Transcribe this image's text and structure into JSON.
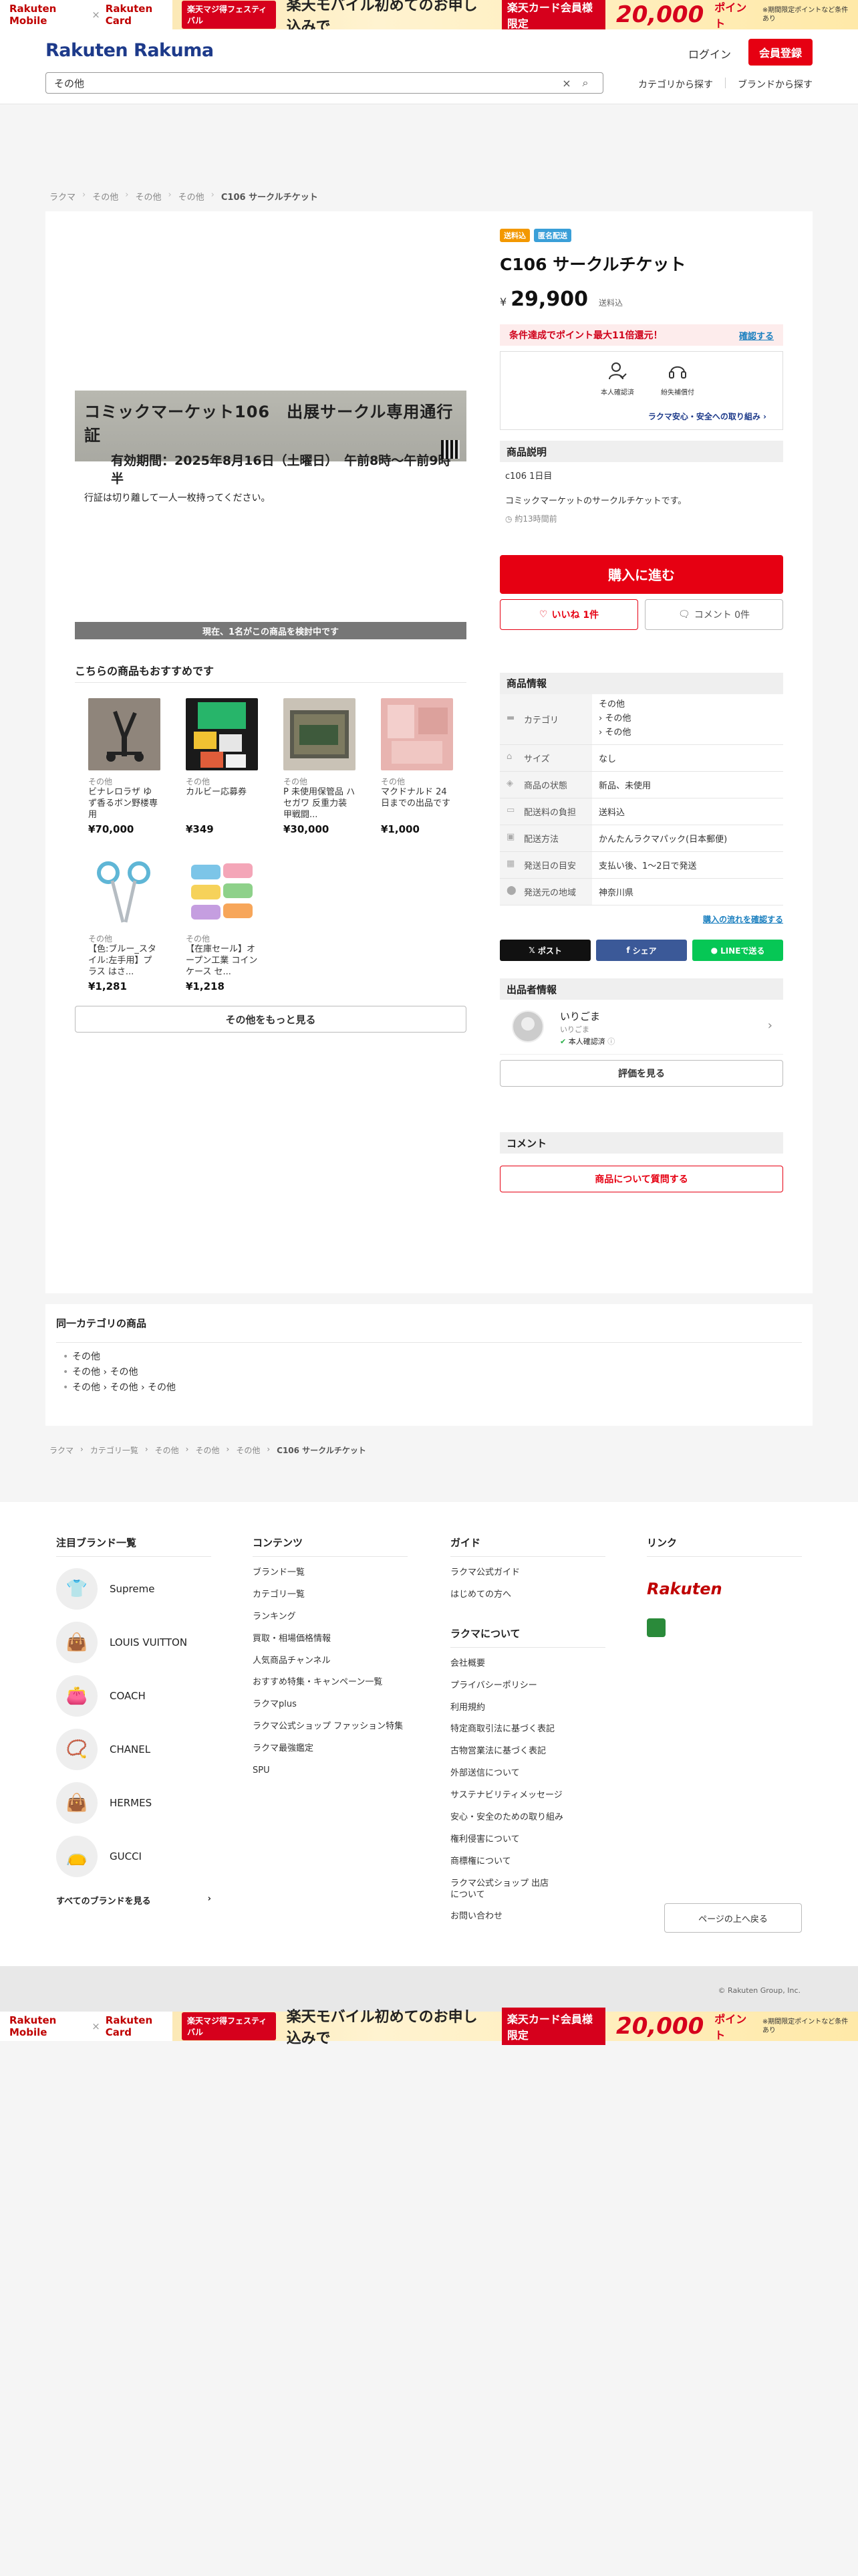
{
  "banner": {
    "logo_mobile": "Rakuten Mobile",
    "logo_x": "×",
    "logo_card": "Rakuten Card",
    "fest": "楽天マジ得フェスティバル",
    "main_text": "楽天モバイル初めてのお申し込みで",
    "card_text": "楽天カード会員様限定",
    "points": "20,000",
    "pt_label": "ポイント",
    "note": "※期間限定ポイントなど条件あり"
  },
  "header": {
    "logo": "Rakuten Rakuma",
    "login": "ログイン",
    "signup": "会員登録",
    "search_value": "その他",
    "clear_icon": "×",
    "search_icon": "⌕",
    "nav_category": "カテゴリから探す",
    "nav_brand": "ブランドから探す"
  },
  "breadcrumb": [
    "ラクマ",
    "その他",
    "その他",
    "その他",
    "C106 サークルチケット"
  ],
  "photo": {
    "ticket_line1": "コミックマーケット106　出展サークル専用通行証",
    "ticket_line2": "有効期間：2025年8月16日（土曜日）　午前8時～午前9時半",
    "ticket_line3": "行証は切り離して一人一枚持ってください。",
    "viewing": "現在、1名がこの商品を検討中です"
  },
  "recommend": {
    "title": "こちらの商品もおすすめです",
    "items": [
      {
        "cat": "その他",
        "name": "ビナレロラザ ゆず香るボン野楼専用",
        "price": "¥70,000"
      },
      {
        "cat": "その他",
        "name": "カルビー応募券",
        "price": "¥349"
      },
      {
        "cat": "その他",
        "name": "P 未使用保管品 ハセガワ 反重力装甲戦闘...",
        "price": "¥30,000"
      },
      {
        "cat": "その他",
        "name": "マクドナルド 24日までの出品です",
        "price": "¥1,000"
      },
      {
        "cat": "その他",
        "name": "【色:ブルー_スタイル:左手用】プラス はさ...",
        "price": "¥1,281"
      },
      {
        "cat": "その他",
        "name": "【在庫セール】オープン工業 コインケース セ...",
        "price": "¥1,218"
      }
    ],
    "more": "その他をもっと見る"
  },
  "item": {
    "badge_ship": "送料込",
    "badge_anon": "匿名配送",
    "title": "C106 サークルチケット",
    "yen": "¥",
    "price": "29,900",
    "tax": "送料込",
    "point_text": "条件達成でポイント最大11倍還元！",
    "point_check": "確認する",
    "safety1": "本人確認済",
    "safety2": "紛失補償付",
    "safety_link": "ラクマ安心・安全への取り組み",
    "desc_head": "商品説明",
    "desc1": "c106 1日目",
    "desc2": "コミックマーケットのサークルチケットです。",
    "desc_time": "約13時間前",
    "buy": "購入に進む",
    "like": "いいね 1件",
    "comment": "コメント 0件"
  },
  "info": {
    "head": "商品情報",
    "rows": [
      {
        "k": "カテゴリ",
        "v": [
          "その他",
          "› その他",
          "› その他"
        ]
      },
      {
        "k": "サイズ",
        "v": [
          "なし"
        ]
      },
      {
        "k": "商品の状態",
        "v": [
          "新品、未使用"
        ]
      },
      {
        "k": "配送料の負担",
        "v": [
          "送料込"
        ]
      },
      {
        "k": "配送方法",
        "v": [
          "かんたんラクマパック(日本郵便)"
        ]
      },
      {
        "k": "発送日の目安",
        "v": [
          "支払い後、1〜2日で発送"
        ]
      },
      {
        "k": "発送元の地域",
        "v": [
          "神奈川県"
        ]
      }
    ],
    "flow": "購入の流れを確認する"
  },
  "share": {
    "x": "ポスト",
    "fb": "シェア",
    "line": "LINEで送る"
  },
  "seller": {
    "head": "出品者情報",
    "name": "いりごま",
    "sub": "いりごま",
    "verified": "本人確認済",
    "review": "評価を見る"
  },
  "comment": {
    "head": "コメント",
    "ask": "商品について質問する"
  },
  "same_cat": {
    "head": "同一カテゴリの商品",
    "items": [
      "その他",
      "その他 › その他",
      "その他 › その他 › その他"
    ]
  },
  "breadcrumb2": [
    "ラクマ",
    "カテゴリ一覧",
    "その他",
    "その他",
    "その他",
    "C106 サークルチケット"
  ],
  "footer": {
    "brands_head": "注目ブランド一覧",
    "brands": [
      "Supreme",
      "LOUIS VUITTON",
      "COACH",
      "CHANEL",
      "HERMES",
      "GUCCI"
    ],
    "all_brands": "すべてのブランドを見る",
    "contents_head": "コンテンツ",
    "contents": [
      "ブランド一覧",
      "カテゴリ一覧",
      "ランキング",
      "買取・相場価格情報",
      "人気商品チャンネル",
      "おすすめ特集・キャンペーン一覧",
      "ラクマplus",
      "ラクマ公式ショップ ファッション特集",
      "ラクマ最強鑑定",
      "SPU"
    ],
    "guide_head": "ガイド",
    "guide": [
      "ラクマ公式ガイド",
      "はじめての方へ"
    ],
    "about_head": "ラクマについて",
    "about": [
      "会社概要",
      "プライバシーポリシー",
      "利用規約",
      "特定商取引法に基づく表記",
      "古物営業法に基づく表記",
      "外部送信について",
      "サステナビリティメッセージ",
      "安心・安全のための取り組み",
      "権利侵害について",
      "商標権について",
      "ラクマ公式ショップ 出店について",
      "お問い合わせ"
    ],
    "links_head": "リンク",
    "rakuten": "Rakuten",
    "to_top": "ページの上へ戻る",
    "copyright": "© Rakuten Group, Inc."
  }
}
